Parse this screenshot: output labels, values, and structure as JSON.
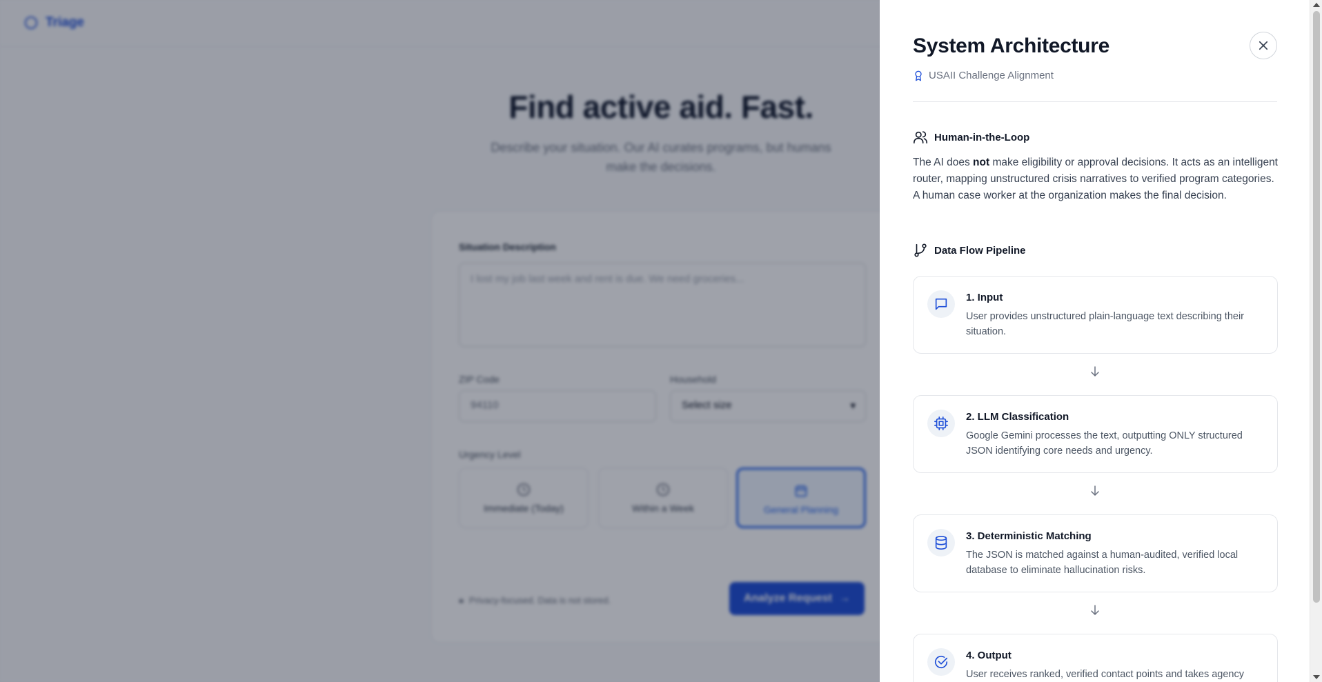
{
  "app": {
    "brand": "Triage",
    "hero_title": "Find active aid. Fast.",
    "hero_subtitle": "Describe your situation. Our AI curates programs, but humans make the decisions.",
    "situation_label": "Situation Description",
    "situation_placeholder": "I lost my job last week and rent is due. We need groceries...",
    "zip_label": "ZIP Code",
    "zip_value": "94110",
    "household_label": "Household",
    "household_value": "Select size",
    "urgency_label": "Urgency Level",
    "urgency_options": [
      "Immediate (Today)",
      "Within a Week",
      "General Planning"
    ],
    "privacy_text": "Privacy-focused. Data is not stored.",
    "analyze_label": "Analyze Request"
  },
  "drawer": {
    "title": "System Architecture",
    "subtitle": "USAII Challenge Alignment",
    "hitl_heading": "Human-in-the-Loop",
    "hitl_pre": "The AI does ",
    "hitl_bold": "not",
    "hitl_post": " make eligibility or approval decisions. It acts as an intelligent router, mapping unstructured crisis narratives to verified program categories. A human case worker at the organization makes the final decision.",
    "pipeline_heading": "Data Flow Pipeline",
    "steps": [
      {
        "title": "1. Input",
        "desc": "User provides unstructured plain-language text describing their situation.",
        "icon": "message-icon"
      },
      {
        "title": "2. LLM Classification",
        "desc": "Google Gemini processes the text, outputting ONLY structured JSON identifying core needs and urgency.",
        "icon": "cpu-icon"
      },
      {
        "title": "3. Deterministic Matching",
        "desc": "The JSON is matched against a human-audited, verified local database to eliminate hallucination risks.",
        "icon": "database-icon"
      },
      {
        "title": "4. Output",
        "desc": "User receives ranked, verified contact points and takes agency",
        "icon": "check-circle-icon"
      }
    ]
  },
  "colors": {
    "accent": "#1d4ed8",
    "overlay": "#0f172a"
  }
}
